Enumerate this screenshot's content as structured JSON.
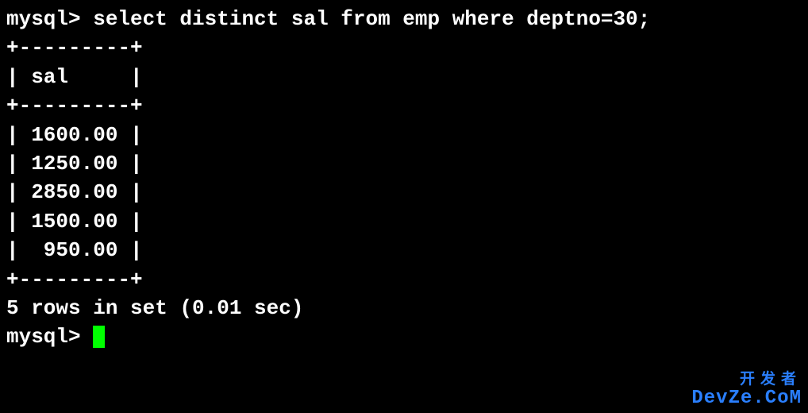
{
  "prompt1": "mysql> ",
  "query": "select distinct sal from emp where deptno=30;",
  "border": "+---------+",
  "header": "| sal     |",
  "rows": [
    "| 1600.00 |",
    "| 1250.00 |",
    "| 2850.00 |",
    "| 1500.00 |",
    "|  950.00 |"
  ],
  "summary": "5 rows in set (0.01 sec)",
  "blank": "",
  "prompt2": "mysql> ",
  "watermark": {
    "top": "开发者",
    "bottom_prefix": "DevZe",
    "bottom_suffix": ".CoM"
  },
  "chart_data": {
    "type": "table",
    "title": "select distinct sal from emp where deptno=30",
    "columns": [
      "sal"
    ],
    "rows": [
      [
        1600.0
      ],
      [
        1250.0
      ],
      [
        2850.0
      ],
      [
        1500.0
      ],
      [
        950.0
      ]
    ],
    "row_count": 5,
    "elapsed_sec": 0.01
  }
}
